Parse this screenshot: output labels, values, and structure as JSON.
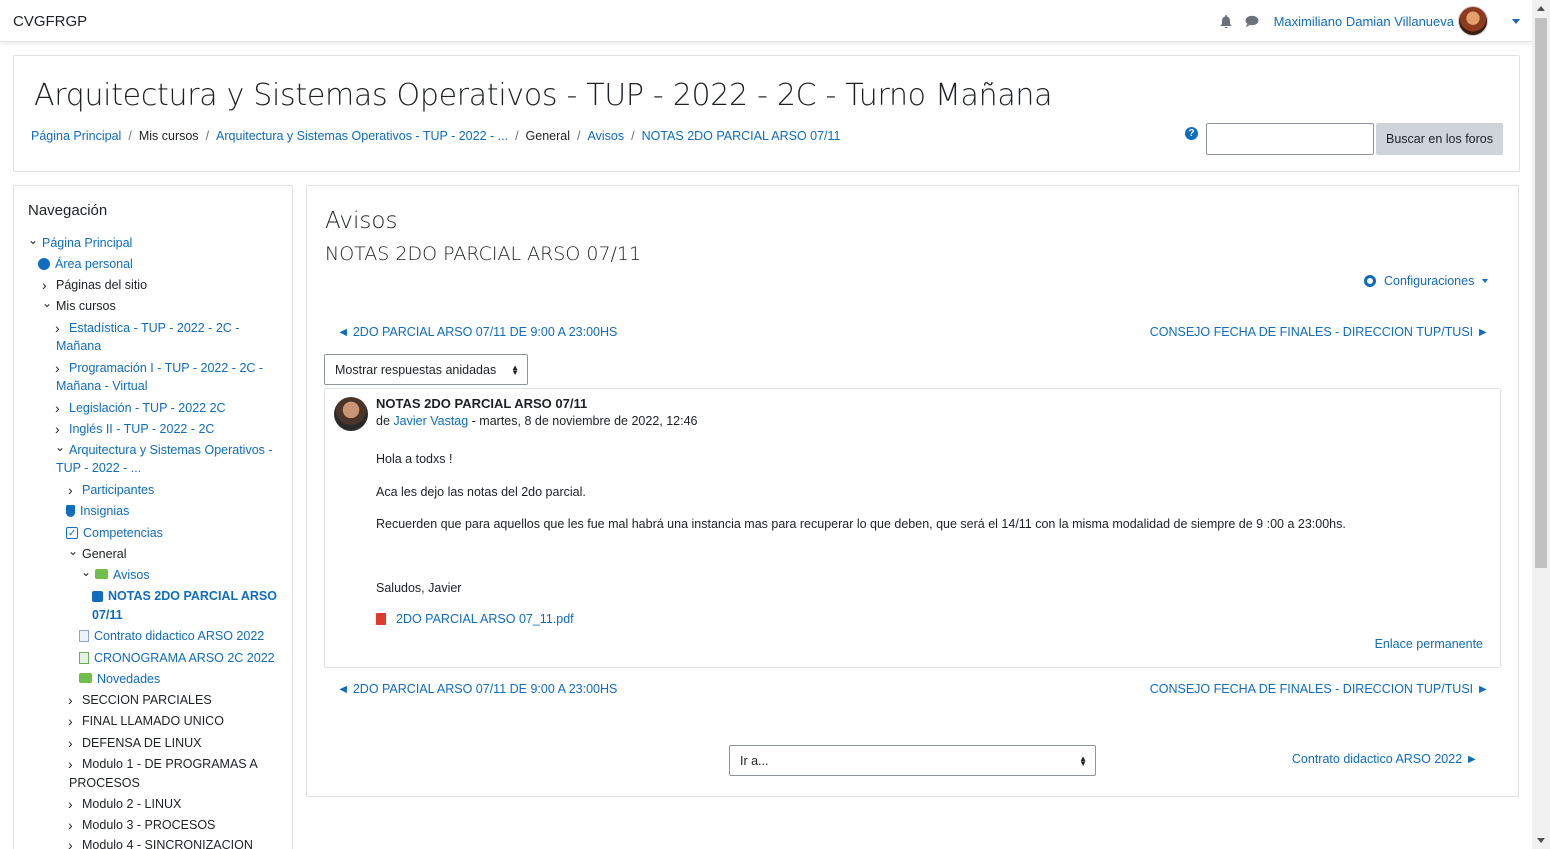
{
  "navbar": {
    "brand": "CVGFRGP",
    "user_name": "Maximiliano Damian Villanueva"
  },
  "header": {
    "course_title": "Arquitectura y Sistemas Operativos - TUP - 2022 - 2C - Turno Mañana",
    "breadcrumb": [
      "Página Principal",
      "Mis cursos",
      "Arquitectura y Sistemas Operativos - TUP - 2022 - ...",
      "General",
      "Avisos",
      "NOTAS 2DO PARCIAL ARSO 07/11"
    ],
    "search_value": "",
    "search_button": "Buscar en los foros",
    "help": "?"
  },
  "sidebar": {
    "title": "Navegación",
    "items": [
      "Página Principal",
      "Área personal",
      "Páginas del sitio",
      "Mis cursos",
      "Estadística - TUP - 2022 - 2C -",
      "Mañana",
      "Programación I - TUP - 2022 - 2C -",
      "Mañana - Virtual",
      "Legislación - TUP - 2022 2C",
      "Inglés II - TUP - 2022 - 2C",
      "Arquitectura y Sistemas Operativos -",
      "TUP - 2022 - ...",
      "Participantes",
      "Insignias",
      "Competencias",
      "General",
      "Avisos",
      "NOTAS 2DO PARCIAL ARSO",
      "07/11",
      "Contrato didactico ARSO 2022",
      "CRONOGRAMA ARSO 2C 2022",
      "Novedades",
      "SECCION PARCIALES",
      "FINAL LLAMADO UNICO",
      "DEFENSA DE LINUX",
      "Modulo 1 - DE PROGRAMAS A",
      "PROCESOS",
      "Modulo 2 - LINUX",
      "Modulo 3 - PROCESOS",
      "Modulo 4 - SINCRONIZACION"
    ]
  },
  "main": {
    "forum_title": "Avisos",
    "discussion_title": "NOTAS 2DO PARCIAL ARSO 07/11",
    "settings_label": "Configuraciones",
    "prev_discussion": "◄ 2DO PARCIAL ARSO 07/11 DE 9:00 A 23:00HS",
    "next_discussion": "CONSEJO FECHA DE FINALES - DIRECCION TUP/TUSI ►",
    "display_mode": "Mostrar respuestas anidadas",
    "post": {
      "subject": "NOTAS 2DO PARCIAL ARSO 07/11",
      "by_prefix": "de",
      "author": "Javier Vastag",
      "date": " - martes, 8 de noviembre de 2022, 12:46",
      "paragraphs": [
        "Hola a todxs !",
        "Aca les dejo las notas del 2do parcial.",
        "Recuerden que para aquellos que les fue mal habrá una instancia mas para recuperar lo que deben, que será el 14/11 con la misma modalidad de siempre de 9 :00 a 23:00hs.",
        "Saludos, Javier"
      ],
      "attachment": "2DO PARCIAL ARSO 07_11.pdf",
      "permalink": "Enlace permanente"
    },
    "jump_to": "Ir a...",
    "next_activity": "Contrato didactico ARSO 2022 ►"
  },
  "colors": {
    "link": "#0f6cbf",
    "text": "#1d2125",
    "border": "#dee2e6"
  },
  "icons": [
    "bell-icon",
    "chat-icon",
    "avatar",
    "help-icon",
    "gear-icon",
    "pdf-icon",
    "gauge-icon",
    "shield-icon",
    "checkbox-icon",
    "forum-icon",
    "document-icon",
    "spreadsheet-icon"
  ]
}
